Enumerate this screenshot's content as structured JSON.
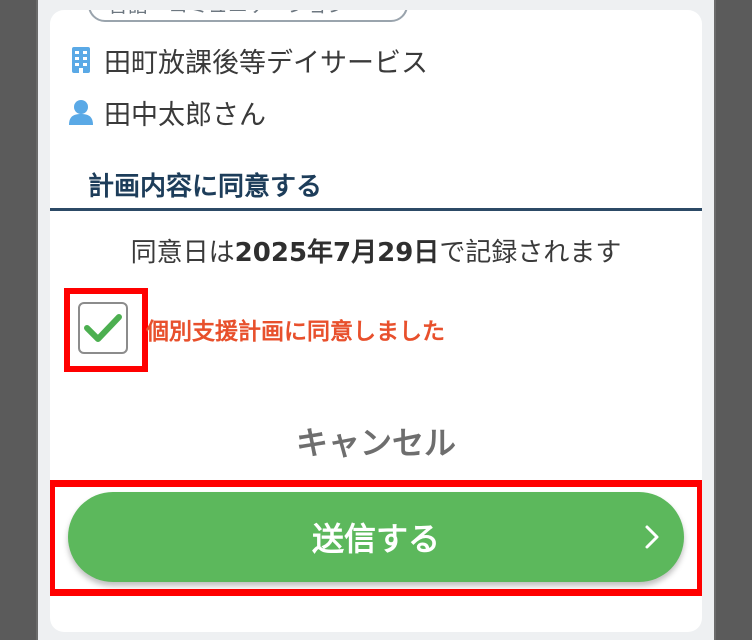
{
  "top_tag": "言語・コミュニケーション",
  "facility": {
    "name": "田町放課後等デイサービス",
    "icon": "building-icon"
  },
  "person": {
    "name": "田中太郎さん",
    "icon": "user-icon"
  },
  "section_title": "計画内容に同意する",
  "consent": {
    "prefix": "同意日は",
    "date": "2025年7月29日",
    "suffix": "で記録されます"
  },
  "checkbox": {
    "label": "個別支援計画に同意しました",
    "checked": true
  },
  "cancel_label": "キャンセル",
  "submit_label": "送信する",
  "colors": {
    "accent_green": "#5cb85c",
    "check_green": "#4caf50",
    "warning_text": "#e8502c",
    "highlight_red": "#ff0000",
    "heading": "#1d3d5a",
    "icon_blue": "#5aa9e6"
  }
}
